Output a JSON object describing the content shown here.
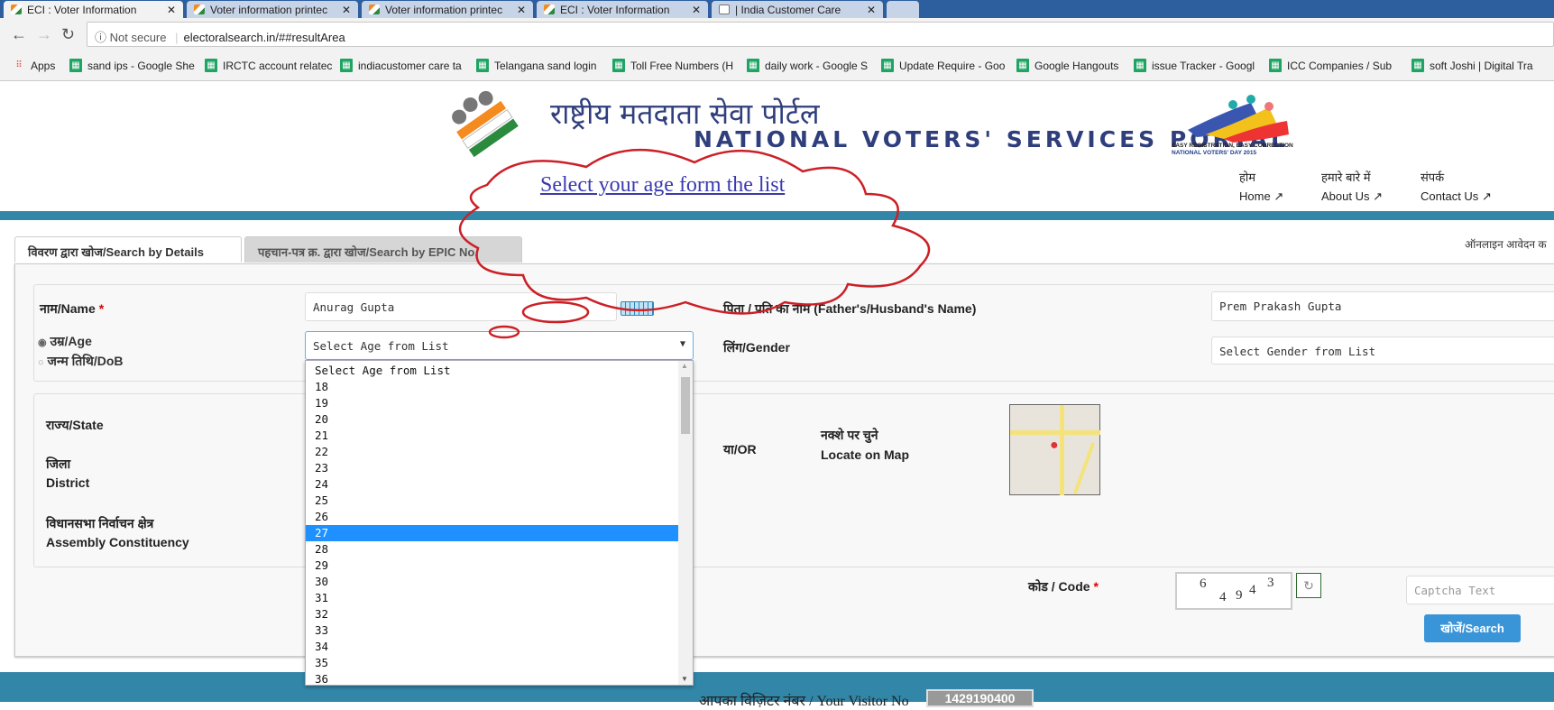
{
  "browser": {
    "tabs": [
      {
        "title": "ECI : Voter Information",
        "active": true
      },
      {
        "title": "Voter information printec"
      },
      {
        "title": "Voter information printec"
      },
      {
        "title": "ECI : Voter Information"
      },
      {
        "title": "| India Customer Care"
      }
    ],
    "security": "Not secure",
    "url": "electoralsearch.in/##resultArea",
    "bookmarks": [
      "Apps",
      "sand ips - Google She",
      "IRCTC account relatec",
      "indiacustomer care ta",
      "Telangana sand login",
      "Toll Free Numbers (H",
      "daily work - Google S",
      "Update Require - Goo",
      "Google Hangouts",
      "issue Tracker - Googl",
      "ICC Companies / Sub",
      "soft Joshi | Digital Tra"
    ]
  },
  "header": {
    "title_hindi": "राष्ट्रीय मतदाता सेवा पोर्टल",
    "title_english": "NATIONAL VOTERS' SERVICES PORTAL",
    "nav": [
      {
        "hindi": "होम",
        "label": "Home"
      },
      {
        "hindi": "हमारे बारे में",
        "label": "About Us"
      },
      {
        "hindi": "संपर्क",
        "label": "Contact Us"
      }
    ],
    "accent_color": "#3287a8"
  },
  "callout": {
    "text": "Select your age form the list",
    "color": "#cc1f26"
  },
  "form": {
    "tabs": [
      "विवरण द्वारा खोज/Search by Details",
      "पहचान-पत्र क्र. द्वारा खोज/Search by EPIC No."
    ],
    "online_apply": "ऑनलाइन आवेदन क",
    "name_label": "नाम/Name",
    "name_value": "Anurag Gupta",
    "age_radio": "उम्र/Age",
    "dob_radio": "जन्म तिथि/DoB",
    "age_mode": "age",
    "age_select": "Select Age from List",
    "age_options": [
      "Select Age from List",
      "18",
      "19",
      "20",
      "21",
      "22",
      "23",
      "24",
      "25",
      "26",
      "27",
      "28",
      "29",
      "30",
      "31",
      "32",
      "33",
      "34",
      "35",
      "36"
    ],
    "age_highlighted": "27",
    "father_label": "पिता / पति का नाम (Father's/Husband's Name)",
    "father_value": "Prem Prakash Gupta",
    "gender_label": "लिंग/Gender",
    "gender_select": "Select Gender from List",
    "state_label": "राज्य/State",
    "district_hindi": "जिला",
    "district_label": "District",
    "ac_hindi": "विधानसभा निर्वाचन क्षेत्र",
    "ac_label": "Assembly Constituency",
    "or_label": "या/OR",
    "map_hindi": "नक्शे पर चुने",
    "map_label": "Locate on Map",
    "code_label": "कोड / Code",
    "captcha": [
      "6",
      "4",
      "9",
      "4",
      "3"
    ],
    "captcha_placeholder": "Captcha Text",
    "search_button": "खोजें/Search"
  },
  "footer": {
    "visitor_label": "आपका विज़िटर नंबर / Your Visitor No",
    "visitor_no": "1429190400"
  }
}
